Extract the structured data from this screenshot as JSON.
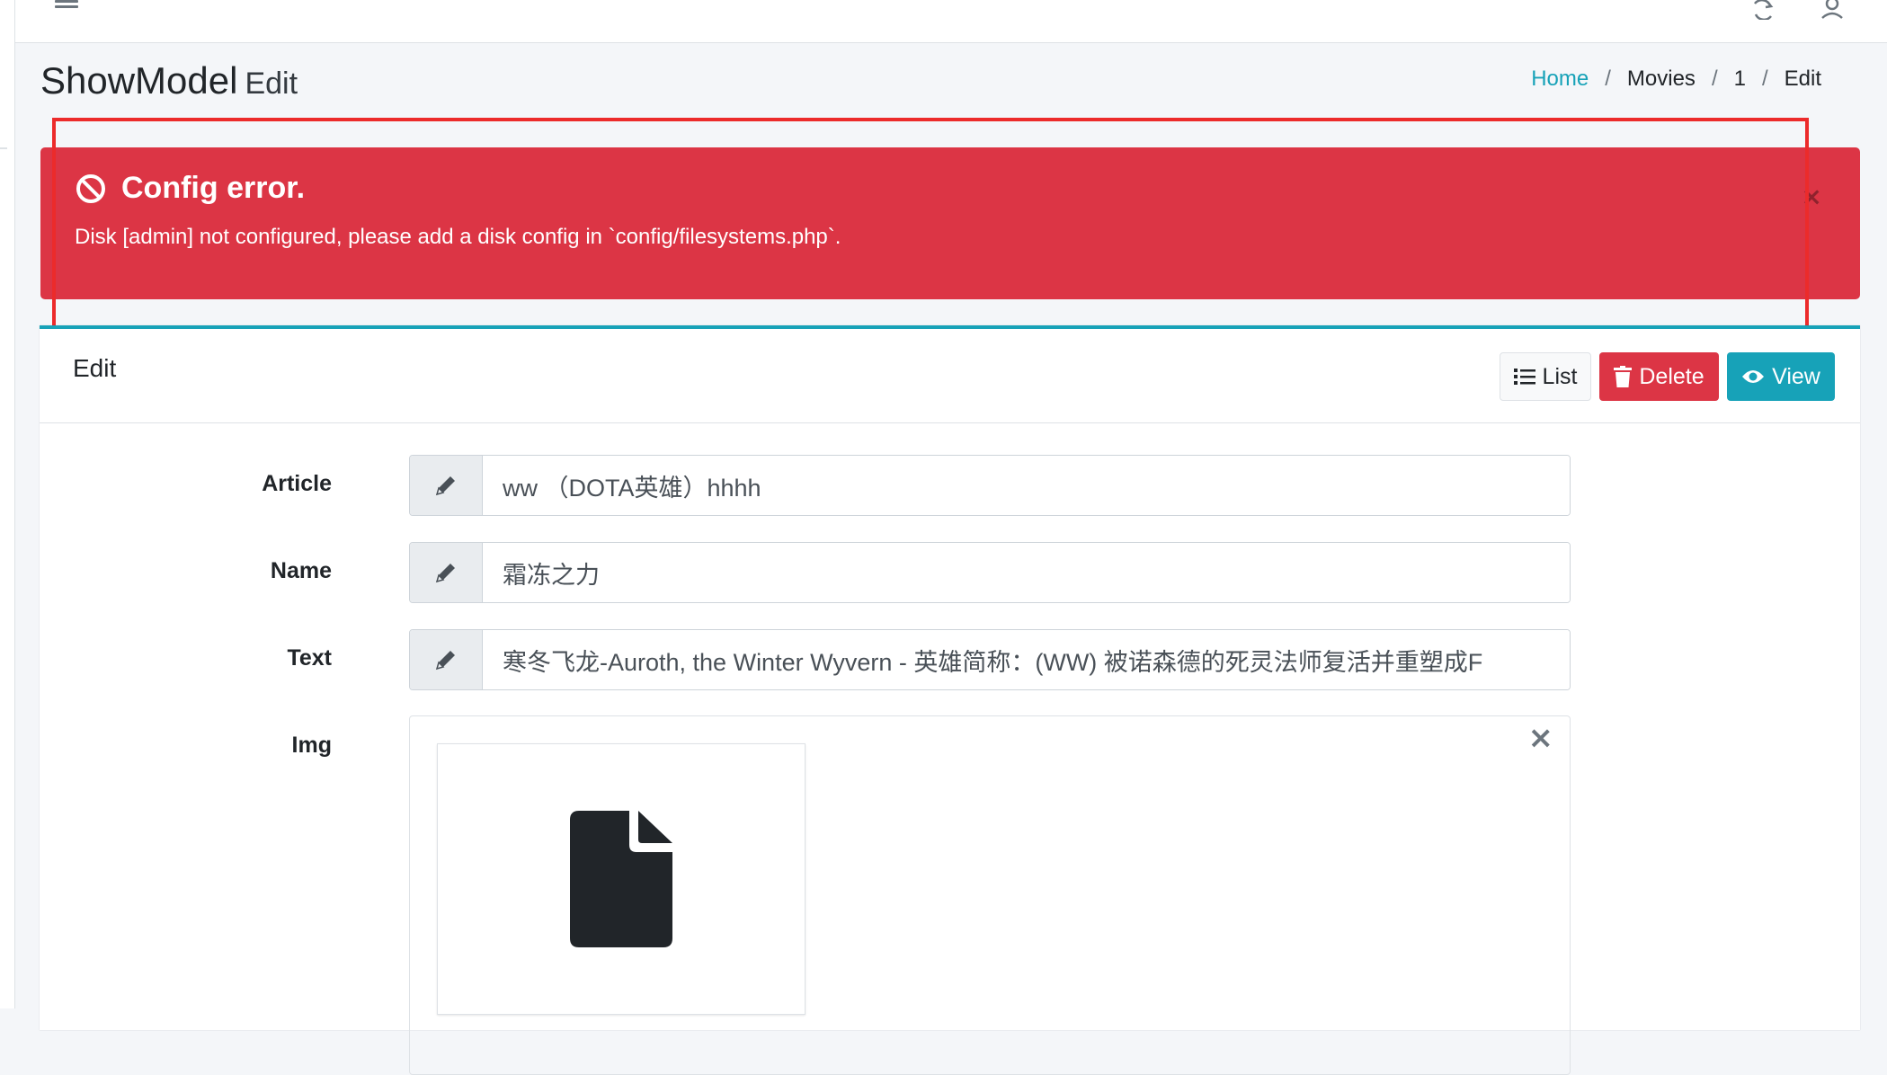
{
  "navbar": {
    "menu_icon": "hamburger-icon",
    "refresh_icon": "refresh-icon",
    "user_icon": "user-icon"
  },
  "header": {
    "title": "ShowModel",
    "subtitle": "Edit",
    "breadcrumb": [
      "Home",
      "Movies",
      "1",
      "Edit"
    ]
  },
  "alert": {
    "title": "Config error.",
    "message": "Disk [admin] not configured, please add a disk config in `config/filesystems.php`.",
    "close": "×",
    "color": "#dc3545"
  },
  "card": {
    "title": "Edit",
    "buttons": {
      "list": "List",
      "delete": "Delete",
      "view": "View"
    },
    "accent": "#17a2b8"
  },
  "form": {
    "fields": [
      {
        "label": "Article",
        "value": "ww （DOTA英雄）hhhh"
      },
      {
        "label": "Name",
        "value": "霜冻之力"
      },
      {
        "label": "Text",
        "value": "寒冬飞龙-Auroth, the Winter Wyvern - 英雄简称：(WW) 被诺森德的死灵法师复活并重塑成F"
      }
    ],
    "img_label": "Img",
    "img_close": "×",
    "file_icon": "file-icon"
  }
}
